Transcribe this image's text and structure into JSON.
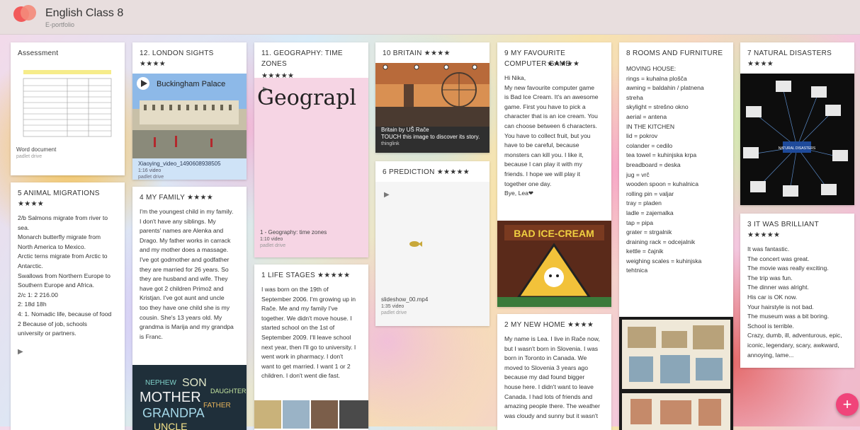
{
  "header": {
    "title": "English Class 8",
    "subtitle": "E-portfolio"
  },
  "cards": {
    "assessment": {
      "title": "Assessment",
      "file": "Word document",
      "source": "padlet drive"
    },
    "animal": {
      "title": "5 ANIMAL MIGRATIONS",
      "stars": "★★★★",
      "lines": [
        "2/b Salmons migrate from river to",
        "sea.",
        "Monarch butterfly migrate from",
        "North America to Mexico.",
        "Arctic terns migrate from Arctic to",
        "Antarctic.",
        "Swallows from Northern Europe to",
        "Southern Europe and Africa.",
        "2/c 1: 2 216.00",
        "2: 18d 18h",
        "4: 1. Nomadic life, because of food",
        "2 Because of job, schools",
        "university or partners."
      ]
    },
    "london": {
      "title": "12. LONDON SIGHTS ★★★★",
      "banner": "Buckingham Palace",
      "file": "Xiaoying_video_1490608938505",
      "meta": "1:16 video",
      "source": "padlet drive"
    },
    "family": {
      "title": "4 MY FAMILY ★★★★",
      "lines": [
        "I'm the youngest child in my family.",
        "I don't have any siblings. My",
        "parents' names are Alenka and",
        "Drago. My father works in carrack",
        "and my mother does a massage.",
        "I've got godmother and godfather",
        "they are married for 26 years. So",
        "they are husband and wife. They",
        "have got 2 children Primož and",
        "Kristjan. I've got aunt and uncle",
        "too they have one child she is my",
        "cousin. She's 13 years old. My",
        "grandma is Marija and my grandpa",
        "is Franc."
      ],
      "wordcloud": [
        "NEPHEW",
        "SON",
        "MOTHER",
        "GRANDPA",
        "FATHER",
        "UNCLE",
        "DAUGHTER"
      ]
    },
    "geography": {
      "title": "11. GEOGRAPHY: TIME ZONES",
      "stars": "★★★★★",
      "handwriting": "Geograpl",
      "file": "1 - Geography: time zones",
      "meta": "1:10 video",
      "source": "padlet drive"
    },
    "life": {
      "title": "1 LIFE STAGES ★★★★★",
      "lines": [
        "I was born on the 19th of",
        "September 2006. I'm growing up in",
        "Rače. Me and my family I've",
        "together. We didn't move house. I",
        "started school on the 1st of",
        "September 2009. I'll leave school",
        "next year, then I'll go to university. I",
        "went work in pharmacy. I don't",
        "want to get married. I want 1 or 2",
        "children. I don't went die fast."
      ]
    },
    "britain": {
      "title": "10 BRITAIN ★★★★",
      "caption": "Britain by UŠ Rače",
      "caption2": "TOUCH this image to discover its story.",
      "source": "thinglink"
    },
    "prediction": {
      "title": "6 PREDICTION ★★★★★",
      "file": "slideshow_00.mp4",
      "meta": "1:35 video",
      "source": "padlet drive"
    },
    "game": {
      "title": "9 MY FAVOURITE COMPUTER GAME",
      "stars": "★★★★★",
      "lines": [
        "Hi Nika,",
        "My new favourite computer game",
        "is Bad Ice Cream. It's an awesome",
        "game. First you have to pick a",
        "character that is an ice cream. You",
        "can choose between 6 characters.",
        "You have to collect fruit, but you",
        "have to be careful, because",
        "monsters can kill you. I like it,",
        "because I can play it with my",
        "friends. I hope we will play it",
        "together one day.",
        "Bye, Lea❤"
      ],
      "logo": "BAD ICE-CREAM"
    },
    "home": {
      "title": "2 MY NEW HOME ★★★★",
      "lines": [
        "My name is Lea. I live in Rače now,",
        "but I wasn't born in Slovenia. I was",
        "born in Toronto in Canada. We",
        "moved to Slovenia 3 years ago",
        "because my dad found bigger",
        "house here. I didn't want to leave",
        "Canada. I had lots of friends and",
        "amazing people there. The weather",
        "was cloudy and sunny but it wasn't"
      ]
    },
    "rooms": {
      "title": "8 ROOMS AND FURNITURE",
      "lines": [
        "MOVING HOUSE:",
        "rings = kuhalna plošča",
        "awning = baldahin / platnena",
        "streha",
        "skylight = strešno okno",
        "aerial = antena",
        "IN THE KITCHEN",
        "lid = pokrov",
        "colander = cedilo",
        "tea towel = kuhinjska krpa",
        "breadboard = deska",
        "jug = vrč",
        "wooden spoon = kuhalnica",
        "rolling pin = valjar",
        "tray = pladen",
        "ladle = zajemalka",
        "tap = pipa",
        "grater = strgalnik",
        "draining rack = odcejalnik",
        "kettle = čajnik",
        "weighing scales = kuhinjska",
        "tehtnica"
      ]
    },
    "disasters": {
      "title": "7 NATURAL DISASTERS",
      "stars": "★★★★",
      "center": "NATURAL DISASTERS"
    },
    "brilliant": {
      "title": "3 IT WAS BRILLIANT ★★★★★",
      "lines": [
        "It was fantastic.",
        "The concert was great.",
        "The movie was really exciting.",
        "The trip was fun.",
        "The dinner was alright.",
        "His car is OK now.",
        "Your hairstyle is not bad.",
        "The museum was a bit boring.",
        "School is terrible.",
        "Crazy, dumb, ill, adventurous, epic,",
        "iconic, legendary, scary, awkward,",
        "annoying, lame..."
      ]
    }
  },
  "fab": {
    "label": "+"
  }
}
